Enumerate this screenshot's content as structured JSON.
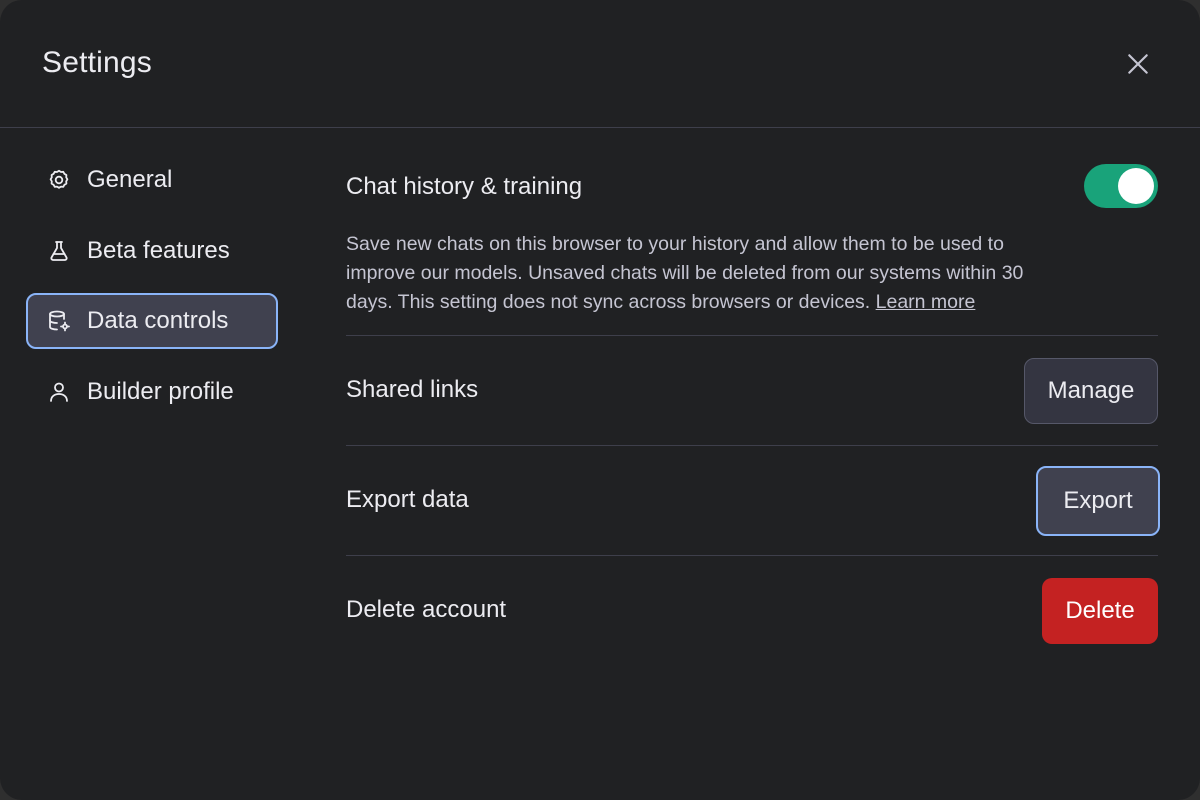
{
  "dialog": {
    "title": "Settings"
  },
  "sidebar": {
    "items": [
      {
        "label": "General",
        "icon": "gear-icon"
      },
      {
        "label": "Beta features",
        "icon": "flask-icon"
      },
      {
        "label": "Data controls",
        "icon": "database-gear-icon",
        "active": true
      },
      {
        "label": "Builder profile",
        "icon": "user-icon"
      }
    ]
  },
  "chat_history": {
    "label": "Chat history & training",
    "enabled": true,
    "description": "Save new chats on this browser to your history and allow them to be used to improve our models. Unsaved chats will be deleted from our systems within 30 days. This setting does not sync across browsers or devices.",
    "learn_more": "Learn more"
  },
  "shared_links": {
    "label": "Shared links",
    "button": "Manage"
  },
  "export_data": {
    "label": "Export data",
    "button": "Export"
  },
  "delete_account": {
    "label": "Delete account",
    "button": "Delete"
  },
  "colors": {
    "background": "#202123",
    "toggle_on": "#19a37a",
    "focus_ring": "#8ab4f8",
    "danger": "#c42222"
  }
}
